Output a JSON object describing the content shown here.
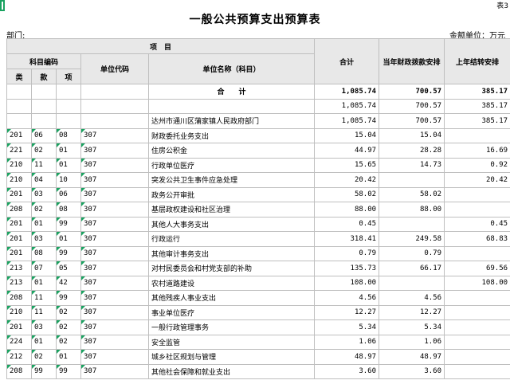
{
  "corner_label": "表3",
  "title": "一般公共预算支出预算表",
  "dept_label": "部门:",
  "unit_label": "金额单位：万元",
  "headers": {
    "project": "项　目",
    "subject_code": "科目编码",
    "lei": "类",
    "kuan": "款",
    "xiang": "项",
    "unit_code": "单位代码",
    "unit_name": "单位名称（科目）",
    "total": "合计",
    "current_year": "当年财政拨款安排",
    "last_year": "上年结转安排"
  },
  "summary_rows": [
    {
      "name": "合　　计",
      "total": "1,085.74",
      "current": "700.57",
      "last": "385.17"
    },
    {
      "name": "",
      "total": "1,085.74",
      "current": "700.57",
      "last": "385.17"
    },
    {
      "name": "达州市通川区蒲家镇人民政府部门",
      "total": "1,085.74",
      "current": "700.57",
      "last": "385.17"
    }
  ],
  "rows": [
    {
      "lei": "201",
      "kuan": "06",
      "xiang": "08",
      "unit": "307",
      "name": "财政委托业务支出",
      "total": "15.04",
      "current": "15.04",
      "last": ""
    },
    {
      "lei": "221",
      "kuan": "02",
      "xiang": "01",
      "unit": "307",
      "name": "住房公积金",
      "total": "44.97",
      "current": "28.28",
      "last": "16.69"
    },
    {
      "lei": "210",
      "kuan": "11",
      "xiang": "01",
      "unit": "307",
      "name": "行政单位医疗",
      "total": "15.65",
      "current": "14.73",
      "last": "0.92"
    },
    {
      "lei": "210",
      "kuan": "04",
      "xiang": "10",
      "unit": "307",
      "name": "突发公共卫生事件应急处理",
      "total": "20.42",
      "current": "",
      "last": "20.42"
    },
    {
      "lei": "201",
      "kuan": "03",
      "xiang": "06",
      "unit": "307",
      "name": "政务公开审批",
      "total": "58.02",
      "current": "58.02",
      "last": ""
    },
    {
      "lei": "208",
      "kuan": "02",
      "xiang": "08",
      "unit": "307",
      "name": "基层政权建设和社区治理",
      "total": "88.00",
      "current": "88.00",
      "last": ""
    },
    {
      "lei": "201",
      "kuan": "01",
      "xiang": "99",
      "unit": "307",
      "name": "其他人大事务支出",
      "total": "0.45",
      "current": "",
      "last": "0.45"
    },
    {
      "lei": "201",
      "kuan": "03",
      "xiang": "01",
      "unit": "307",
      "name": "行政运行",
      "total": "318.41",
      "current": "249.58",
      "last": "68.83"
    },
    {
      "lei": "201",
      "kuan": "08",
      "xiang": "99",
      "unit": "307",
      "name": "其他审计事务支出",
      "total": "0.79",
      "current": "0.79",
      "last": ""
    },
    {
      "lei": "213",
      "kuan": "07",
      "xiang": "05",
      "unit": "307",
      "name": "对村民委员会和村党支部的补助",
      "total": "135.73",
      "current": "66.17",
      "last": "69.56"
    },
    {
      "lei": "213",
      "kuan": "01",
      "xiang": "42",
      "unit": "307",
      "name": "农村道路建设",
      "total": "108.00",
      "current": "",
      "last": "108.00"
    },
    {
      "lei": "208",
      "kuan": "11",
      "xiang": "99",
      "unit": "307",
      "name": "其他残疾人事业支出",
      "total": "4.56",
      "current": "4.56",
      "last": ""
    },
    {
      "lei": "210",
      "kuan": "11",
      "xiang": "02",
      "unit": "307",
      "name": "事业单位医疗",
      "total": "12.27",
      "current": "12.27",
      "last": ""
    },
    {
      "lei": "201",
      "kuan": "03",
      "xiang": "02",
      "unit": "307",
      "name": "一般行政管理事务",
      "total": "5.34",
      "current": "5.34",
      "last": ""
    },
    {
      "lei": "224",
      "kuan": "01",
      "xiang": "02",
      "unit": "307",
      "name": "安全监管",
      "total": "1.06",
      "current": "1.06",
      "last": ""
    },
    {
      "lei": "212",
      "kuan": "02",
      "xiang": "01",
      "unit": "307",
      "name": "城乡社区规划与管理",
      "total": "48.97",
      "current": "48.97",
      "last": ""
    },
    {
      "lei": "208",
      "kuan": "99",
      "xiang": "99",
      "unit": "307",
      "name": "其他社会保障和就业支出",
      "total": "3.60",
      "current": "3.60",
      "last": ""
    }
  ]
}
